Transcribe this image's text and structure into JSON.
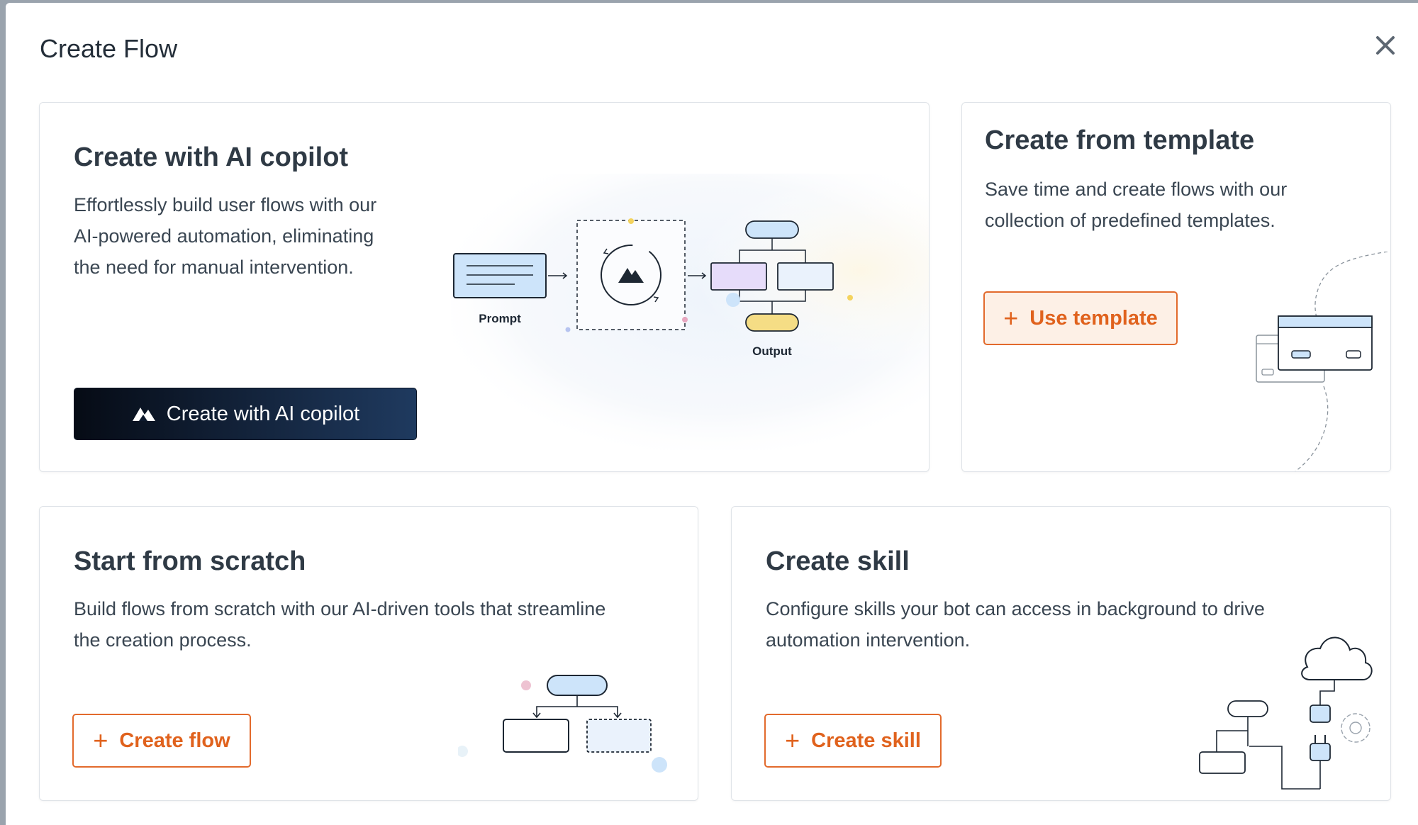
{
  "modal": {
    "title": "Create Flow",
    "close_icon": "close-icon"
  },
  "cards": {
    "ai_copilot": {
      "title": "Create with AI copilot",
      "description": [
        "Effortlessly build user flows with our",
        "AI-powered automation, eliminating",
        "the need for manual intervention."
      ],
      "button_label": "Create with AI copilot",
      "illustration": {
        "prompt_label": "Prompt",
        "output_label": "Output"
      }
    },
    "template": {
      "title": "Create from template",
      "description": [
        "Save time and create flows with our",
        "collection of predefined templates."
      ],
      "button_label": "Use template"
    },
    "scratch": {
      "title": "Start from scratch",
      "description": [
        "Build flows from scratch with our AI-driven tools that streamline",
        "the creation process."
      ],
      "button_label": "Create flow"
    },
    "skill": {
      "title": "Create skill",
      "description": [
        "Configure skills your bot can access in background to drive",
        "automation intervention."
      ],
      "button_label": "Create skill"
    }
  },
  "colors": {
    "accent": "#e0621d",
    "dark_button_start": "#060b15",
    "dark_button_end": "#1f3a5f"
  }
}
